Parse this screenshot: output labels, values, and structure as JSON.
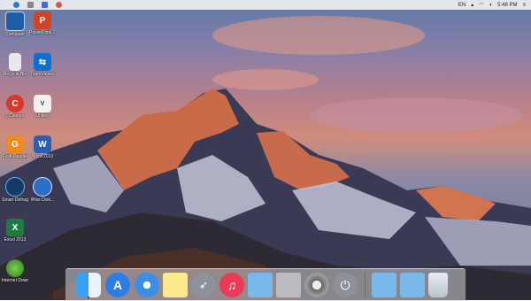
{
  "menubar": {
    "language": "EN",
    "time": "5:48 PM"
  },
  "desktop": {
    "icons": [
      {
        "label": "Computer",
        "icon": "computer-icon"
      },
      {
        "label": "PowerPoint 2013",
        "icon": "powerpoint-icon"
      },
      {
        "label": "Recycle Bin",
        "icon": "recycle-bin-icon"
      },
      {
        "label": "TeamViewer",
        "icon": "teamviewer-icon"
      },
      {
        "label": "CCleaner",
        "icon": "ccleaner-icon"
      },
      {
        "label": "Unikey",
        "icon": "unikey-icon"
      },
      {
        "label": "Foxit Reader",
        "icon": "foxit-reader-icon"
      },
      {
        "label": "Word 2013",
        "icon": "word-icon"
      },
      {
        "label": "Smart Defrag",
        "icon": "smart-defrag-icon"
      },
      {
        "label": "Wise Disk...",
        "icon": "wise-disk-icon"
      },
      {
        "label": "Excel 2013",
        "icon": "excel-icon"
      },
      {
        "label": "Internet Downlo...",
        "icon": "internet-download-icon"
      }
    ]
  },
  "dock": {
    "items": [
      "finder-icon",
      "app-store-icon",
      "safari-icon",
      "notes-icon",
      "launchpad-icon",
      "itunes-icon",
      "folder-icon",
      "macbook-icon",
      "system-preferences-icon",
      "power-icon",
      "folder-icon",
      "folder-icon",
      "trash-icon"
    ]
  }
}
